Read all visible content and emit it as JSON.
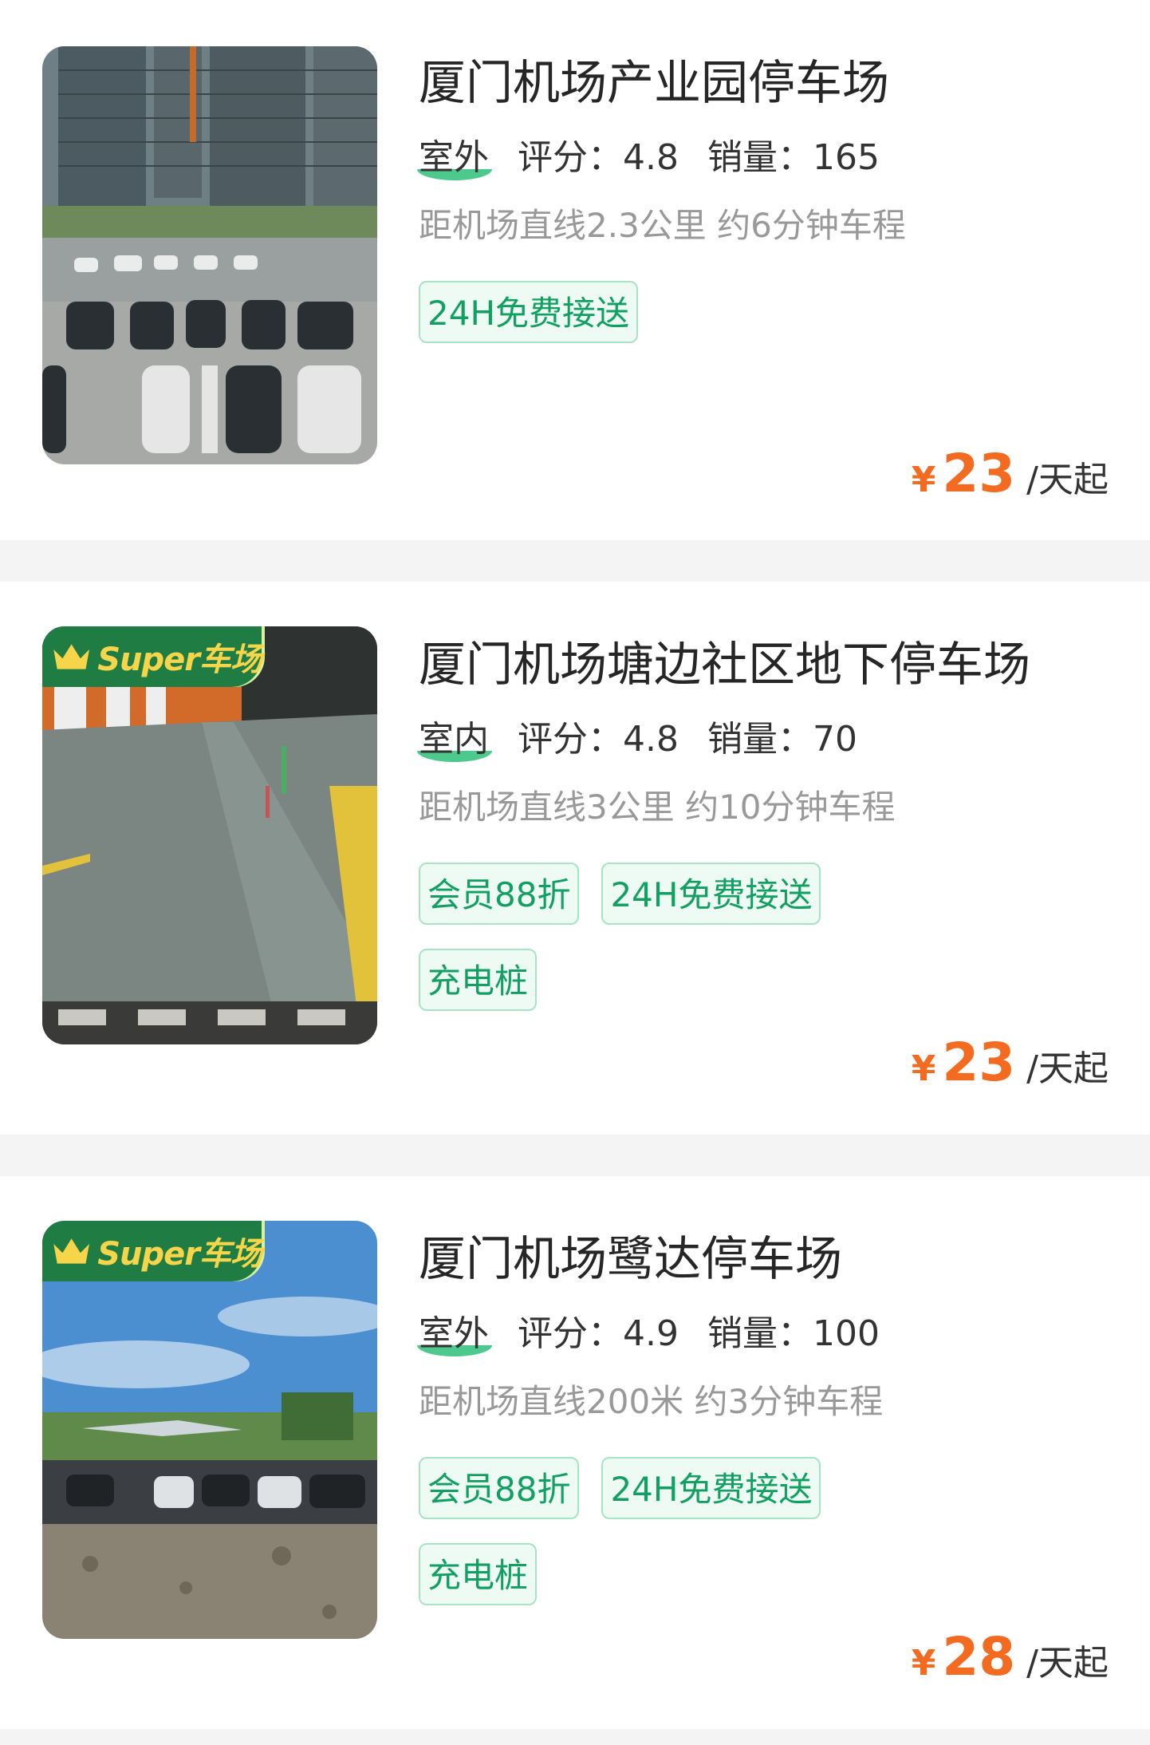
{
  "colors": {
    "accent_price": "#f26b21",
    "tag_green": "#12a062",
    "tag_border": "#a9e3c5",
    "badge_green": "#1f7c43",
    "badge_text": "#f6d54a"
  },
  "lots": [
    {
      "name": "厦门机场产业园停车场",
      "type": "室外",
      "rating": "评分：4.8",
      "sales": "销量：165",
      "distance": "距机场直线2.3公里 约6分钟车程",
      "tags": [
        "24H免费接送"
      ],
      "super_badge": "",
      "price_symbol": "¥",
      "price": "23",
      "price_unit": "/天起",
      "image_icon": "outdoor-parking-lot-photo"
    },
    {
      "name": "厦门机场塘边社区地下停车场",
      "type": "室内",
      "rating": "评分：4.8",
      "sales": "销量：70",
      "distance": "距机场直线3公里 约10分钟车程",
      "tags": [
        "会员88折",
        "24H免费接送",
        "充电桩"
      ],
      "super_badge": "Super车场",
      "price_symbol": "¥",
      "price": "23",
      "price_unit": "/天起",
      "image_icon": "underground-garage-photo"
    },
    {
      "name": "厦门机场鹭达停车场",
      "type": "室外",
      "rating": "评分：4.9",
      "sales": "销量：100",
      "distance": "距机场直线200米 约3分钟车程",
      "tags": [
        "会员88折",
        "24H免费接送",
        "充电桩"
      ],
      "super_badge": "Super车场",
      "price_symbol": "¥",
      "price": "28",
      "price_unit": "/天起",
      "image_icon": "open-air-lot-photo"
    }
  ]
}
